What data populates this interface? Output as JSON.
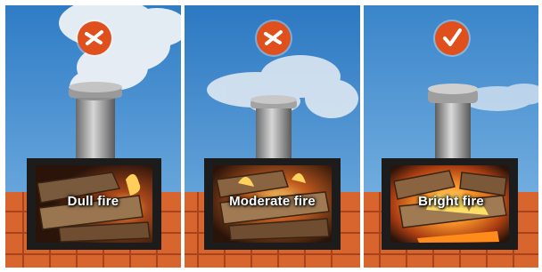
{
  "panels": [
    {
      "label": "Dull fire",
      "verdict_icon": "cross-mark-icon",
      "smoke": "heavy"
    },
    {
      "label": "Moderate fire",
      "verdict_icon": "cross-mark-icon",
      "smoke": "moderate"
    },
    {
      "label": "Bright fire",
      "verdict_icon": "check-mark-icon",
      "smoke": "light"
    }
  ],
  "colors": {
    "badge": "#e0501c",
    "sky": "#3a82c8",
    "roof_tile": "#d8642e",
    "frame": "#1c1c1c"
  }
}
